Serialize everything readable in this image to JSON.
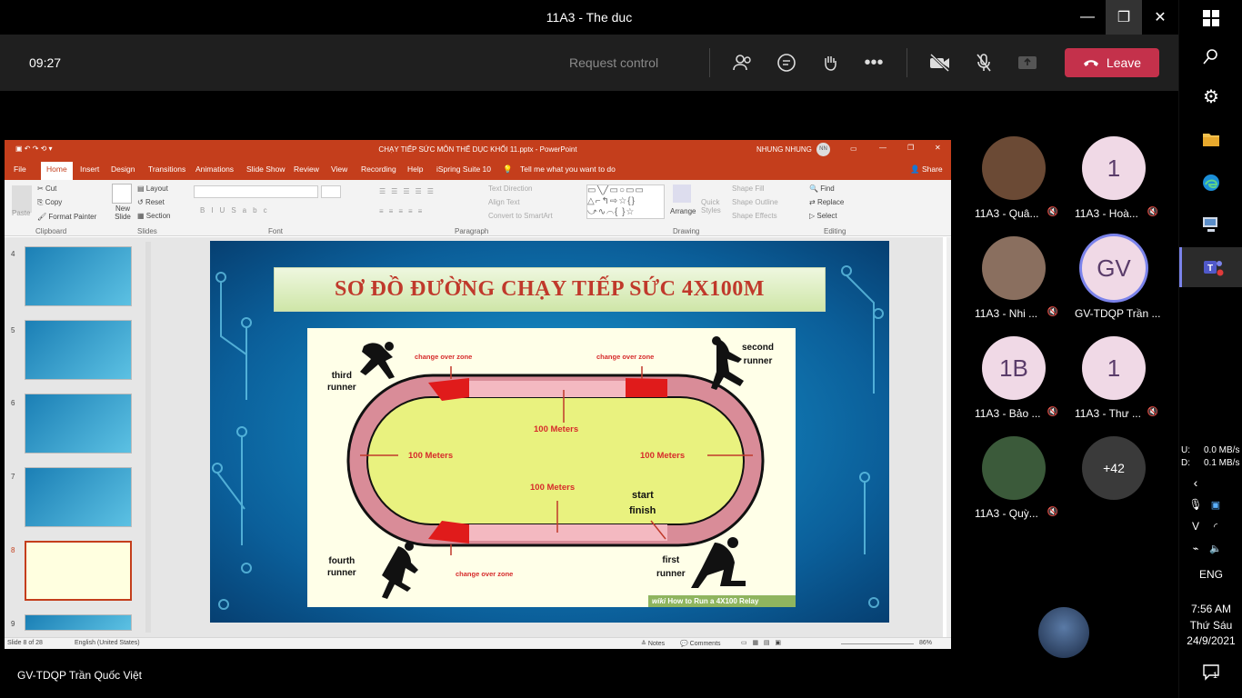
{
  "window": {
    "title": "11A3 - The duc",
    "minimize": "—",
    "restore": "❐",
    "close": "✕"
  },
  "meeting": {
    "clock": "09:27",
    "request_control": "Request control",
    "leave_label": "Leave"
  },
  "ppt": {
    "file_title": "CHẠY TIẾP SỨC MÔN THỂ DỤC KHỐI 11.pptx - PowerPoint",
    "user_name": "NHUNG NHUNG",
    "user_initials": "NN",
    "tabs": [
      "File",
      "Home",
      "Insert",
      "Design",
      "Transitions",
      "Animations",
      "Slide Show",
      "Review",
      "View",
      "Recording",
      "Help",
      "iSpring Suite 10"
    ],
    "tell_me": "Tell me what you want to do",
    "share": "Share",
    "ribbon": {
      "cut": "Cut",
      "copy": "Copy",
      "format_painter": "Format Painter",
      "paste": "Paste",
      "clipboard": "Clipboard",
      "new_slide": "New Slide",
      "layout": "Layout",
      "reset": "Reset",
      "section": "Section",
      "slides": "Slides",
      "font": "Font",
      "paragraph": "Paragraph",
      "text_direction": "Text Direction",
      "align_text": "Align Text",
      "convert_smartart": "Convert to SmartArt",
      "arrange": "Arrange",
      "quick_styles": "Quick Styles",
      "shape_fill": "Shape Fill",
      "shape_outline": "Shape Outline",
      "shape_effects": "Shape Effects",
      "drawing": "Drawing",
      "find": "Find",
      "replace": "Replace",
      "select": "Select",
      "editing": "Editing"
    },
    "thumb_numbers": [
      "4",
      "5",
      "6",
      "7",
      "8",
      "9"
    ],
    "status": {
      "slide_of": "Slide 8 of 28",
      "language": "English (United States)",
      "notes": "Notes",
      "comments": "Comments",
      "zoom": "86%"
    }
  },
  "slide": {
    "title": "SƠ ĐỒ ĐƯỜNG CHẠY TIẾP SỨC 4X100M",
    "labels": {
      "third_runner_1": "third",
      "third_runner_2": "runner",
      "second_runner_1": "second",
      "second_runner_2": "runner",
      "fourth_runner_1": "fourth",
      "fourth_runner_2": "runner",
      "first_runner_1": "first",
      "first_runner_2": "runner",
      "change_zone_tl": "change over zone",
      "change_zone_tr": "change over zone",
      "change_zone_bl": "change over zone",
      "m_top": "100 Meters",
      "m_left": "100 Meters",
      "m_right": "100 Meters",
      "m_bottom": "100 Meters",
      "start": "start",
      "finish": "finish",
      "watermark": "How to Run a 4X100 Relay"
    }
  },
  "participants": [
    {
      "name": "11A3 - Quâ...",
      "initials": "",
      "color": "#6b4a35"
    },
    {
      "name": "11A3 - Hoà...",
      "initials": "1",
      "color": "#f0d9e6"
    },
    {
      "name": "11A3 - Nhi ...",
      "initials": "",
      "color": "#8a6f5f"
    },
    {
      "name": "GV-TDQP Trần ...",
      "initials": "GV",
      "color": "#f0d9e6"
    },
    {
      "name": "11A3 - Bảo ...",
      "initials": "1B",
      "color": "#f0d9e6"
    },
    {
      "name": "11A3 - Thư ...",
      "initials": "1",
      "color": "#f0d9e6"
    },
    {
      "name": "11A3 - Quỳ...",
      "initials": "",
      "color": "#3b5a3a"
    },
    {
      "name": "",
      "initials": "+42",
      "color": "#3a3a3a"
    }
  ],
  "presenter": "GV-TDQP Trần Quốc Việt",
  "taskbar": {
    "net_up_label": "U:",
    "net_up": "0.0 MB/s",
    "net_down_label": "D:",
    "net_down": "0.1 MB/s",
    "lang": "ENG",
    "time": "7:56 AM",
    "day": "Thứ Sáu",
    "date": "24/9/2021",
    "notif": "1"
  }
}
